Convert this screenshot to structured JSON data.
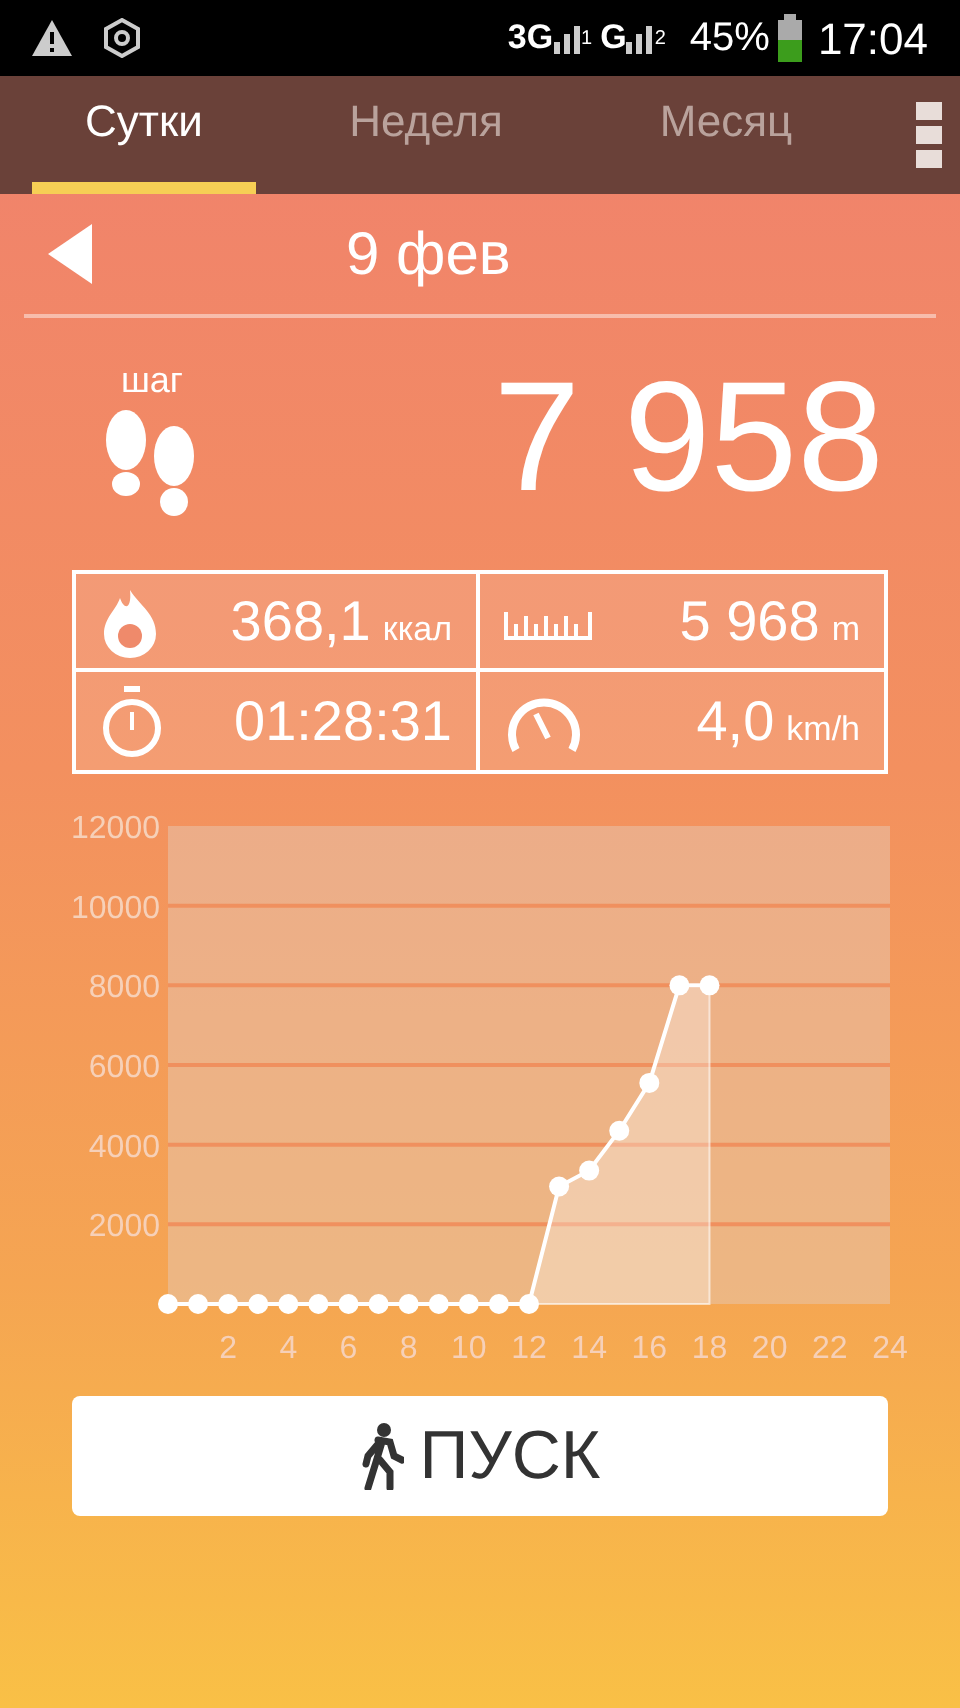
{
  "status_bar": {
    "network_1": "3G",
    "sim_1": "1",
    "network_2": "G",
    "sim_2": "2",
    "battery": "45%",
    "time": "17:04"
  },
  "tabs": [
    {
      "label": "Сутки",
      "selected": true
    },
    {
      "label": "Неделя",
      "selected": false
    },
    {
      "label": "Месяц",
      "selected": false
    }
  ],
  "date": "9 фев",
  "steps": {
    "label": "шаг",
    "value": "7 958"
  },
  "stats": [
    {
      "kind": "calories",
      "value": "368,1",
      "unit": "ккал"
    },
    {
      "kind": "distance",
      "value": "5 968",
      "unit": "m"
    },
    {
      "kind": "duration",
      "value": "01:28:31"
    },
    {
      "kind": "speed",
      "value": "4,0",
      "unit": "km/h"
    }
  ],
  "chart_data": {
    "type": "area",
    "x": [
      0,
      1,
      2,
      3,
      4,
      5,
      6,
      7,
      8,
      9,
      10,
      11,
      12,
      13,
      14,
      15,
      16,
      17,
      18
    ],
    "series": [
      {
        "color": "#ffffff",
        "values": [
          0,
          0,
          0,
          0,
          0,
          0,
          0,
          0,
          0,
          0,
          0,
          0,
          0,
          2950,
          3350,
          4350,
          5550,
          8000,
          8000
        ]
      }
    ],
    "xlim": [
      0,
      24
    ],
    "ylim": [
      0,
      12000
    ],
    "xticks": [
      2,
      4,
      6,
      8,
      10,
      12,
      14,
      16,
      18,
      20,
      22,
      24
    ],
    "yticks": [
      2000,
      4000,
      6000,
      8000,
      10000,
      12000
    ],
    "grid": true
  },
  "start_button": "ПУСК"
}
